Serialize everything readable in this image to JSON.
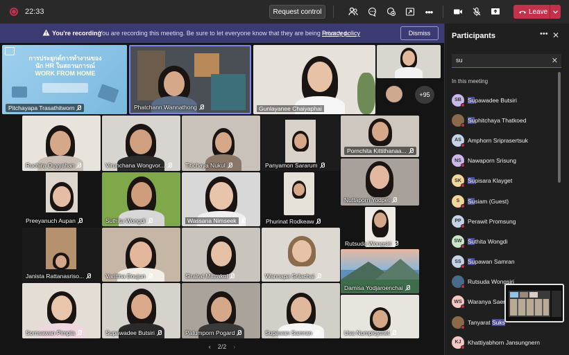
{
  "topbar": {
    "time": "22:33",
    "request_control": "Request control",
    "leave": "Leave"
  },
  "banner": {
    "title": "You're recording",
    "message": "You are recording this meeting. Be sure to let everyone know that they are being recorded.",
    "link": "Privacy policy",
    "dismiss": "Dismiss"
  },
  "stage": {
    "shared_content": {
      "line1": "การประยุกต์การทำงานของ",
      "line2": "นัก HR ในสถานการณ์",
      "line3": "WORK FROM HOME"
    },
    "top_row": [
      "Pitchayapa Trasathitworn",
      "Phatchann Wannathong",
      "Gunlayanee Chaiyaphai"
    ],
    "overflow_count": "+95",
    "grid": [
      "Ruchira Ouyyahan",
      "Virunchana Wongvor...",
      "Titichaya Nukul",
      "Panyamon Sararum",
      "Pornchita Kittithanaa...",
      "Nuttaporn Yodpet",
      "Preeyanuch Aupan",
      "Suthita Wongdi",
      "Wassana Nimseek",
      "Phurinat Rodkeaw",
      "Rutsuda Wongsiri",
      "Janista Rattanasriso...",
      "Varittha Boujun",
      "Sirairat Mittrakul",
      "Wannapa Srilachai",
      "Damisa Yodjaroenchai",
      "Sornsawan Pimpla",
      "Supawadee Butsiri",
      "Patumporn Pogard",
      "Supawan Samran",
      "Usa Numploythet"
    ],
    "pager": "2/2"
  },
  "panel": {
    "title": "Participants",
    "search_value": "su",
    "section": "In this meeting",
    "participants": [
      {
        "initials": "SB",
        "pre": "",
        "match": "Su",
        "post": "pawadee Butsiri",
        "color": "#c9b8e8"
      },
      {
        "initials": "",
        "pre": "",
        "match": "Su",
        "post": "phitchaya Thatkoed",
        "color": "#8a6a4a"
      },
      {
        "initials": "AS",
        "pre": "Amphorn Sriprasertsuk",
        "match": "",
        "post": "",
        "color": "#c5d3e8"
      },
      {
        "initials": "NS",
        "pre": "Nawaporn Srisung",
        "match": "",
        "post": "",
        "color": "#c9b8e8"
      },
      {
        "initials": "SK",
        "pre": "",
        "match": "Su",
        "post": "pisara Klayget",
        "color": "#f2d69b"
      },
      {
        "initials": "S",
        "pre": "",
        "match": "Su",
        "post": "siam (Guest)",
        "color": "#f2d69b"
      },
      {
        "initials": "PP",
        "pre": "Perawit Promsung",
        "match": "",
        "post": "",
        "color": "#c5d3e8"
      },
      {
        "initials": "SW",
        "pre": "",
        "match": "Su",
        "post": "thita Wongdi",
        "color": "#c8e6c9"
      },
      {
        "initials": "SS",
        "pre": "",
        "match": "Su",
        "post": "pawan Samran",
        "color": "#c5d3e8"
      },
      {
        "initials": "",
        "pre": "Rutsuda Wongsiri",
        "match": "",
        "post": "",
        "color": "#4a6a8a"
      },
      {
        "initials": "WS",
        "pre": "Waranya Saens",
        "match": "",
        "post": "",
        "color": "#f4c7c3"
      },
      {
        "initials": "",
        "pre": "Tanyarat ",
        "match": "Suks",
        "post": "",
        "color": "#8a6a4a"
      },
      {
        "initials": "KJ",
        "pre": "Khattiyabhorn Jansungnern",
        "match": "",
        "post": "",
        "color": "#f4c7c3"
      }
    ]
  }
}
